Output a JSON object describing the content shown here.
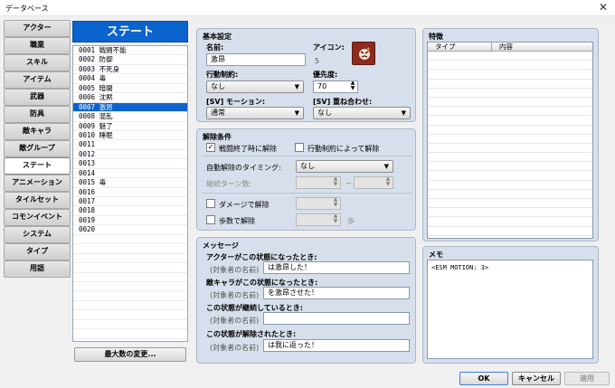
{
  "window": {
    "title": "データベース",
    "close_glyph": "✕"
  },
  "tabs": [
    {
      "label": "アクター"
    },
    {
      "label": "職業"
    },
    {
      "label": "スキル"
    },
    {
      "label": "アイテム"
    },
    {
      "label": "武器"
    },
    {
      "label": "防具"
    },
    {
      "label": "敵キャラ"
    },
    {
      "label": "敵グループ"
    },
    {
      "label": "ステート",
      "active": true
    },
    {
      "label": "アニメーション"
    },
    {
      "label": "タイルセット"
    },
    {
      "label": "コモンイベント"
    },
    {
      "label": "システム"
    },
    {
      "label": "タイプ"
    },
    {
      "label": "用語"
    }
  ],
  "state_list": {
    "header": "ステート",
    "selected_index": 6,
    "items": [
      "0001 戦闘不能",
      "0002 防御",
      "0003 不死身",
      "0004 毒",
      "0005 暗闇",
      "0006 沈黙",
      "0007 激昂",
      "0008 混乱",
      "0009 魅了",
      "0010 睡眠",
      "0011",
      "0012",
      "0013",
      "0014",
      "0015 毒",
      "0016",
      "0017",
      "0018",
      "0019",
      "0020"
    ],
    "max_button": "最大数の変更..."
  },
  "basic": {
    "title": "基本設定",
    "name_label": "名前:",
    "name_value": "激昂",
    "icon_label": "アイコン:",
    "icon_index": "5",
    "restriction_label": "行動制約:",
    "restriction_value": "なし",
    "priority_label": "優先度:",
    "priority_value": "70",
    "motion_label": "[SV] モーション:",
    "motion_value": "通常",
    "overlay_label": "[SV] 重ね合わせ:",
    "overlay_value": "なし"
  },
  "removal": {
    "title": "解除条件",
    "battle_end_label": "戦闘終了時に解除",
    "battle_end_checked": true,
    "restriction_remove_label": "行動制約によって解除",
    "restriction_remove_checked": false,
    "auto_timing_label": "自動解除のタイミング:",
    "auto_timing_value": "なし",
    "turns_label": "継続ターン数:",
    "turns_min": "",
    "tilde": "~",
    "turns_max": "",
    "damage_label": "ダメージで解除",
    "damage_checked": false,
    "damage_value": "",
    "steps_label": "歩数で解除",
    "steps_checked": false,
    "steps_value": "",
    "steps_unit": "歩"
  },
  "messages": {
    "title": "メッセージ",
    "actor_label": "アクターがこの状態になったとき:",
    "actor_prefix": "(対象者の名前)",
    "actor_value": "は激昂した！",
    "enemy_label": "敵キャラがこの状態になったとき:",
    "enemy_prefix": "(対象者の名前)",
    "enemy_value": "を激昂させた！",
    "persist_label": "この状態が継続しているとき:",
    "persist_prefix": "(対象者の名前)",
    "persist_value": "",
    "removed_label": "この状態が解除されたとき:",
    "removed_prefix": "(対象者の名前)",
    "removed_value": "は我に返った！"
  },
  "traits": {
    "title": "特徴",
    "col_type": "タイプ",
    "col_content": "内容"
  },
  "memo": {
    "title": "メモ",
    "value": "<ESM MOTION: 3>"
  },
  "footer": {
    "ok": "OK",
    "cancel": "キャンセル",
    "apply": "適用"
  }
}
